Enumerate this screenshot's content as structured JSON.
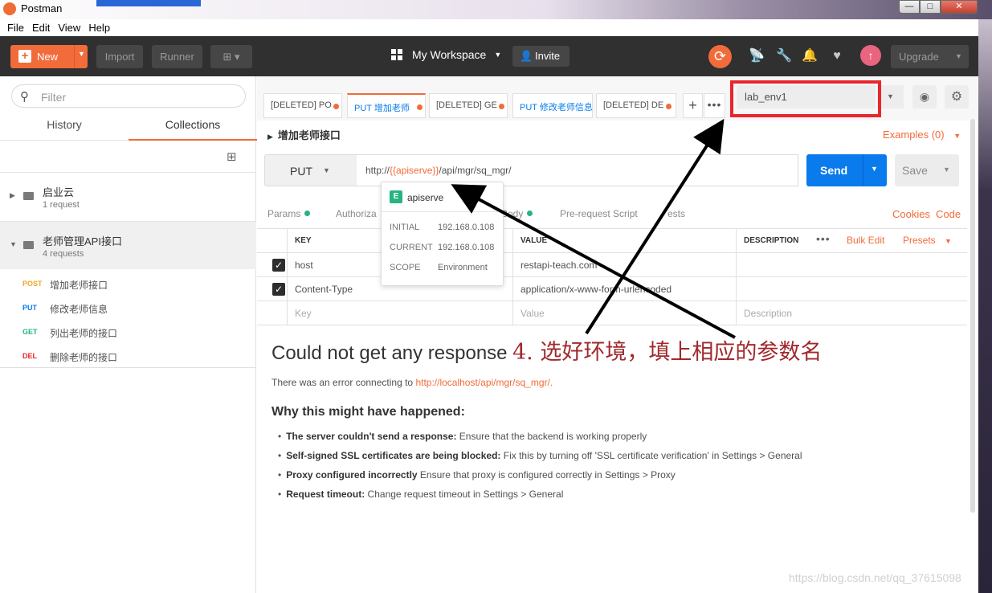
{
  "window": {
    "title": "Postman"
  },
  "menu": [
    "File",
    "Edit",
    "View",
    "Help"
  ],
  "header": {
    "new_label": "New",
    "import_label": "Import",
    "runner_label": "Runner",
    "workspace_label": "My Workspace",
    "invite_label": "Invite",
    "upgrade_label": "Upgrade"
  },
  "sidebar": {
    "filter_placeholder": "Filter",
    "tabs": [
      "History",
      "Collections"
    ],
    "collections": [
      {
        "name": "启业云",
        "count": "1 request"
      },
      {
        "name": "老师管理API接口",
        "count": "4 requests"
      }
    ],
    "requests": [
      {
        "method": "POST",
        "name": "增加老师接口",
        "color": "#f5a623"
      },
      {
        "method": "PUT",
        "name": "修改老师信息",
        "color": "#097bed"
      },
      {
        "method": "GET",
        "name": "列出老师的接口",
        "color": "#26b47f"
      },
      {
        "method": "DEL",
        "name": "删除老师的接口",
        "color": "#e8272b"
      }
    ]
  },
  "tabs": [
    {
      "text": "[DELETED] PO",
      "method": "",
      "active": false
    },
    {
      "text": "PUT 增加老师",
      "method": "PUT",
      "active": true
    },
    {
      "text": "[DELETED] GE",
      "method": "",
      "active": false
    },
    {
      "text": "PUT 修改老师信息",
      "method": "PUT",
      "active": false
    },
    {
      "text": "[DELETED] DE",
      "method": "",
      "active": false
    }
  ],
  "environment": {
    "selected": "lab_env1"
  },
  "request": {
    "title": "增加老师接口",
    "examples_label": "Examples (0)",
    "method": "PUT",
    "url_prefix": "http://",
    "url_var": "{{apiserve}}",
    "url_suffix": "/api/mgr/sq_mgr/",
    "send_label": "Send",
    "save_label": "Save"
  },
  "subtabs": [
    "Params",
    "Authoriza",
    "Body",
    "Pre-request Script",
    "ests"
  ],
  "links": {
    "cookies": "Cookies",
    "code": "Code",
    "bulk_edit": "Bulk Edit",
    "presets": "Presets"
  },
  "params_table": {
    "headers": [
      "KEY",
      "VALUE",
      "DESCRIPTION"
    ],
    "rows": [
      {
        "key": "host",
        "value": "restapi-teach.com",
        "checked": true
      },
      {
        "key": "Content-Type",
        "value": "application/x-www-form-urlencoded",
        "checked": true
      }
    ],
    "placeholders": {
      "key": "Key",
      "value": "Value",
      "description": "Description"
    }
  },
  "tooltip": {
    "badge": "E",
    "name": "apiserve",
    "rows": [
      {
        "label": "INITIAL",
        "value": "192.168.0.108"
      },
      {
        "label": "CURRENT",
        "value": "192.168.0.108"
      },
      {
        "label": "SCOPE",
        "value": "Environment"
      }
    ]
  },
  "response": {
    "title": "Could not get any response",
    "error_prefix": "There was an error connecting to ",
    "error_link": "http://localhost/api/mgr/sq_mgr/.",
    "why_title": "Why this might have happened:",
    "reasons": [
      {
        "bold": "The server couldn't send a response:",
        "text": " Ensure that the backend is working properly"
      },
      {
        "bold": "Self-signed SSL certificates are being blocked:",
        "text": " Fix this by turning off 'SSL certificate verification' in Settings > General"
      },
      {
        "bold": "Proxy configured incorrectly",
        "text": " Ensure that proxy is configured correctly in Settings > Proxy"
      },
      {
        "bold": "Request timeout:",
        "text": " Change request timeout in Settings > General"
      }
    ]
  },
  "annotation": "4. 选好环境，填上相应的参数名",
  "watermark": "https://blog.csdn.net/qq_37615098",
  "colors": {
    "accent": "#f26b3a",
    "send": "#097bed",
    "annotation_box": "#e8272b",
    "annotation_text": "#a0282d"
  }
}
